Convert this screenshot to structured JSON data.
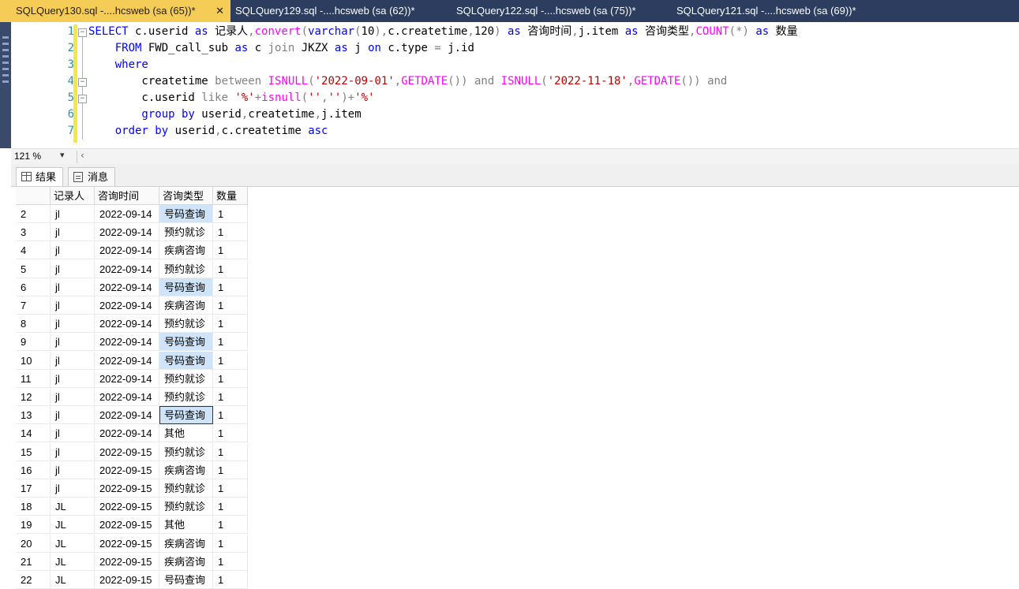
{
  "tabs": [
    {
      "label": "SQLQuery130.sql -....hcsweb (sa (65))*",
      "active": true,
      "close": "✕"
    },
    {
      "label": "SQLQuery129.sql -....hcsweb (sa (62))*",
      "active": false
    },
    {
      "label": "SQLQuery122.sql -....hcsweb (sa (75))*",
      "active": false
    },
    {
      "label": "SQLQuery121.sql -....hcsweb (sa (69))*",
      "active": false
    }
  ],
  "editor": {
    "line_numbers": [
      "1",
      "2",
      "3",
      "4",
      "5",
      "6",
      "7"
    ],
    "lines": [
      [
        {
          "t": "SELECT",
          "c": "kw"
        },
        {
          "t": " c.userid ",
          "c": ""
        },
        {
          "t": "as",
          "c": "kw"
        },
        {
          "t": " 记录人",
          "c": ""
        },
        {
          "t": ",",
          "c": "op"
        },
        {
          "t": "convert",
          "c": "fn"
        },
        {
          "t": "(",
          "c": "op"
        },
        {
          "t": "varchar",
          "c": "kw"
        },
        {
          "t": "(",
          "c": "op"
        },
        {
          "t": "10",
          "c": ""
        },
        {
          "t": "),",
          "c": "op"
        },
        {
          "t": "c.createtime",
          "c": ""
        },
        {
          "t": ",",
          "c": "op"
        },
        {
          "t": "120",
          "c": ""
        },
        {
          "t": ")",
          "c": "op"
        },
        {
          "t": " as",
          "c": "kw"
        },
        {
          "t": " 咨询时间",
          "c": ""
        },
        {
          "t": ",",
          "c": "op"
        },
        {
          "t": "j.item ",
          "c": ""
        },
        {
          "t": "as",
          "c": "kw"
        },
        {
          "t": " 咨询类型",
          "c": ""
        },
        {
          "t": ",",
          "c": "op"
        },
        {
          "t": "COUNT",
          "c": "fn"
        },
        {
          "t": "(*)",
          "c": "op"
        },
        {
          "t": " as",
          "c": "kw"
        },
        {
          "t": " 数量",
          "c": ""
        }
      ],
      [
        {
          "t": "    FROM",
          "c": "kw"
        },
        {
          "t": " FWD_call_sub ",
          "c": ""
        },
        {
          "t": "as",
          "c": "kw"
        },
        {
          "t": " c ",
          "c": ""
        },
        {
          "t": "join",
          "c": "op"
        },
        {
          "t": " JKZX ",
          "c": ""
        },
        {
          "t": "as",
          "c": "kw"
        },
        {
          "t": " j ",
          "c": ""
        },
        {
          "t": "on",
          "c": "kw"
        },
        {
          "t": " c.type ",
          "c": ""
        },
        {
          "t": "=",
          "c": "op"
        },
        {
          "t": " j.id",
          "c": ""
        }
      ],
      [
        {
          "t": "    where",
          "c": "kw"
        }
      ],
      [
        {
          "t": "        createtime ",
          "c": ""
        },
        {
          "t": "between",
          "c": "op"
        },
        {
          "t": " ",
          "c": ""
        },
        {
          "t": "ISNULL",
          "c": "fn"
        },
        {
          "t": "(",
          "c": "op"
        },
        {
          "t": "'2022-09-01'",
          "c": "str"
        },
        {
          "t": ",",
          "c": "op"
        },
        {
          "t": "GETDATE",
          "c": "fn"
        },
        {
          "t": "())",
          "c": "op"
        },
        {
          "t": " ",
          "c": ""
        },
        {
          "t": "and",
          "c": "op"
        },
        {
          "t": " ",
          "c": ""
        },
        {
          "t": "ISNULL",
          "c": "fn"
        },
        {
          "t": "(",
          "c": "op"
        },
        {
          "t": "'2022-11-18'",
          "c": "str"
        },
        {
          "t": ",",
          "c": "op"
        },
        {
          "t": "GETDATE",
          "c": "fn"
        },
        {
          "t": "())",
          "c": "op"
        },
        {
          "t": " ",
          "c": ""
        },
        {
          "t": "and",
          "c": "op"
        }
      ],
      [
        {
          "t": "        c.userid ",
          "c": ""
        },
        {
          "t": "like",
          "c": "op"
        },
        {
          "t": " ",
          "c": ""
        },
        {
          "t": "'%'",
          "c": "str"
        },
        {
          "t": "+",
          "c": "op"
        },
        {
          "t": "isnull",
          "c": "fn"
        },
        {
          "t": "(",
          "c": "op"
        },
        {
          "t": "''",
          "c": "str"
        },
        {
          "t": ",",
          "c": "op"
        },
        {
          "t": "''",
          "c": "str"
        },
        {
          "t": ")+",
          "c": "op"
        },
        {
          "t": "'%'",
          "c": "str"
        }
      ],
      [
        {
          "t": "        group by",
          "c": "kw"
        },
        {
          "t": " userid",
          "c": ""
        },
        {
          "t": ",",
          "c": "op"
        },
        {
          "t": "createtime",
          "c": ""
        },
        {
          "t": ",",
          "c": "op"
        },
        {
          "t": "j.item",
          "c": ""
        }
      ],
      [
        {
          "t": "    order by",
          "c": "kw"
        },
        {
          "t": " userid",
          "c": ""
        },
        {
          "t": ",",
          "c": "op"
        },
        {
          "t": "c.createtime ",
          "c": ""
        },
        {
          "t": "asc",
          "c": "kw"
        }
      ]
    ]
  },
  "zoom": {
    "value": "121 %",
    "arrow": "▾",
    "scroll": "‹"
  },
  "result_tabs": {
    "results": "结果",
    "messages": "消息"
  },
  "grid": {
    "headers": [
      "",
      "记录人",
      "咨询时间",
      "咨询类型",
      "数量"
    ],
    "rows": [
      {
        "n": "2",
        "user": "jl",
        "date": "2022-09-14",
        "type": "号码查询",
        "count": "1",
        "hl": true
      },
      {
        "n": "3",
        "user": "jl",
        "date": "2022-09-14",
        "type": "预约就诊",
        "count": "1"
      },
      {
        "n": "4",
        "user": "jl",
        "date": "2022-09-14",
        "type": "疾病咨询",
        "count": "1"
      },
      {
        "n": "5",
        "user": "jl",
        "date": "2022-09-14",
        "type": "预约就诊",
        "count": "1"
      },
      {
        "n": "6",
        "user": "jl",
        "date": "2022-09-14",
        "type": "号码查询",
        "count": "1",
        "hl": true
      },
      {
        "n": "7",
        "user": "jl",
        "date": "2022-09-14",
        "type": "疾病咨询",
        "count": "1"
      },
      {
        "n": "8",
        "user": "jl",
        "date": "2022-09-14",
        "type": "预约就诊",
        "count": "1"
      },
      {
        "n": "9",
        "user": "jl",
        "date": "2022-09-14",
        "type": "号码查询",
        "count": "1",
        "hl": true
      },
      {
        "n": "10",
        "user": "jl",
        "date": "2022-09-14",
        "type": "号码查询",
        "count": "1",
        "hl": true
      },
      {
        "n": "11",
        "user": "jl",
        "date": "2022-09-14",
        "type": "预约就诊",
        "count": "1"
      },
      {
        "n": "12",
        "user": "jl",
        "date": "2022-09-14",
        "type": "预约就诊",
        "count": "1"
      },
      {
        "n": "13",
        "user": "jl",
        "date": "2022-09-14",
        "type": "号码查询",
        "count": "1",
        "sel": true
      },
      {
        "n": "14",
        "user": "jl",
        "date": "2022-09-14",
        "type": "其他",
        "count": "1"
      },
      {
        "n": "15",
        "user": "jl",
        "date": "2022-09-15",
        "type": "预约就诊",
        "count": "1"
      },
      {
        "n": "16",
        "user": "jl",
        "date": "2022-09-15",
        "type": "疾病咨询",
        "count": "1"
      },
      {
        "n": "17",
        "user": "jl",
        "date": "2022-09-15",
        "type": "预约就诊",
        "count": "1"
      },
      {
        "n": "18",
        "user": "JL",
        "date": "2022-09-15",
        "type": "预约就诊",
        "count": "1"
      },
      {
        "n": "19",
        "user": "JL",
        "date": "2022-09-15",
        "type": "其他",
        "count": "1"
      },
      {
        "n": "20",
        "user": "JL",
        "date": "2022-09-15",
        "type": "疾病咨询",
        "count": "1"
      },
      {
        "n": "21",
        "user": "JL",
        "date": "2022-09-15",
        "type": "疾病咨询",
        "count": "1"
      },
      {
        "n": "22",
        "user": "JL",
        "date": "2022-09-15",
        "type": "号码查询",
        "count": "1"
      }
    ]
  }
}
